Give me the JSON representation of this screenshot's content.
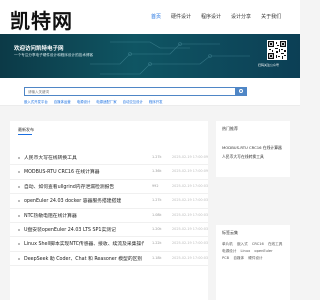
{
  "site": {
    "logo": "凯特网"
  },
  "nav": [
    {
      "label": "首页",
      "active": true
    },
    {
      "label": "硬件设计",
      "active": false
    },
    {
      "label": "程序设计",
      "active": false
    },
    {
      "label": "设计分享",
      "active": false
    },
    {
      "label": "关于我们",
      "active": false
    }
  ],
  "banner": {
    "title": "欢迎访问凯特电子网",
    "subtitle": "一个专注分享电子硬件设计和程序设计的技术博客",
    "qr_label": "扫码关注公众号"
  },
  "search": {
    "placeholder": "请输入关键词",
    "hot_tags": [
      "嵌入式开发平台",
      "自媒体运营",
      "电源设计",
      "电源适配厂家",
      "自动交互设计",
      "程序开发"
    ]
  },
  "main": {
    "tab_label": "最新发布",
    "articles": [
      {
        "title": "人民币大写在线转换工具",
        "views": "1.27k",
        "date": "2025-02-19 17:00:09"
      },
      {
        "title": "MODBUS-RTU CRC16 在线计算器",
        "views": "1.36k",
        "date": "2025-02-19 17:00:09"
      },
      {
        "title": "自动、如何查看uIlgrind内存泄漏检测报告",
        "views": "992",
        "date": "2025-02-19 17:00:03"
      },
      {
        "title": "openEuler 24.03 docker 容器服务搭建搭建",
        "views": "1.27k",
        "date": "2025-02-19 17:00:03"
      },
      {
        "title": "NTC热敏电阻在线计算器",
        "views": "1.08k",
        "date": "2025-02-19 17:00:03"
      },
      {
        "title": "U盘安装openEuler 24.03 LTS SP1实测记",
        "views": "1.20k",
        "date": "2025-02-19 17:00:03"
      },
      {
        "title": "Linux Shell脚本实现NTC传感器、接收、续流及采集操作",
        "views": "1.22k",
        "date": "2025-02-19 17:00:03"
      },
      {
        "title": "DeepSeek 助 Coder、Chat 和 Reasoner 模型的区别",
        "views": "1.18k",
        "date": "2025-02-19 17:00:03"
      }
    ]
  },
  "sidebar": {
    "hot_title": "热门推荐",
    "hot_links": [
      "MODBUS-RTU CRC16 在线计算器",
      "人民币大写在线转换工具"
    ],
    "tags_title": "标签云集",
    "tags": [
      "单片机",
      "嵌入式",
      "CRC16",
      "在线工具",
      "电源设计",
      "Linux",
      "openEuler",
      "PCB",
      "自媒体",
      "硬件设计"
    ]
  },
  "colors": {
    "accent": "#1a6fe0",
    "banner": "#0f5563",
    "search": "#4f86c6"
  }
}
